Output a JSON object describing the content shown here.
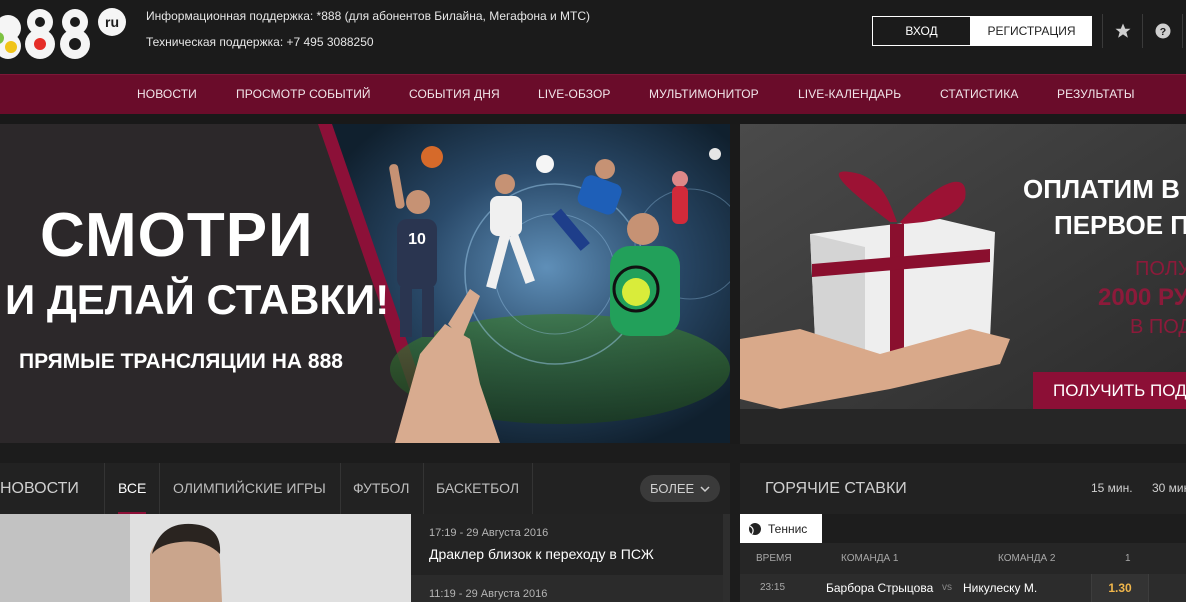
{
  "header": {
    "support_info": "Информационная поддержка: *888 (для абонентов Билайна, Мегафона и МТС)",
    "support_tech": "Техническая поддержка: +7 495 3088250",
    "login_label": "ВХОД",
    "register_label": "РЕГИСТРАЦИЯ",
    "logo_text": "888",
    "logo_domain": "ru"
  },
  "nav": {
    "items": [
      {
        "label": "НОВОСТИ"
      },
      {
        "label": "ПРОСМОТР СОБЫТИЙ"
      },
      {
        "label": "СОБЫТИЯ ДНЯ"
      },
      {
        "label": "LIVE-ОБЗОР"
      },
      {
        "label": "МУЛЬТИМОНИТОР"
      },
      {
        "label": "LIVE-КАЛЕНДАРЬ"
      },
      {
        "label": "СТАТИСТИКА"
      },
      {
        "label": "РЕЗУЛЬТАТЫ"
      }
    ]
  },
  "banner_main": {
    "line1": "СМОТРИ",
    "line2": "И ДЕЛАЙ СТАВКИ!",
    "line3": "ПРЯМЫЕ ТРАНСЛЯЦИИ НА 888",
    "jersey_number": "10"
  },
  "banner_promo": {
    "line1": "ОПЛАТИМ В",
    "line2": "ПЕРВОЕ П",
    "line3": "ПОЛУ",
    "line4": "2000 РУ",
    "line5": "В ПОД",
    "button": "ПОЛУЧИТЬ ПОД"
  },
  "news": {
    "title": "НОВОСТИ",
    "tabs": [
      {
        "label": "ВСЕ"
      },
      {
        "label": "ОЛИМПИЙСКИЕ ИГРЫ"
      },
      {
        "label": "ФУТБОЛ"
      },
      {
        "label": "БАСКЕТБОЛ"
      }
    ],
    "more_label": "БОЛЕЕ",
    "items": [
      {
        "time": "17:19 - 29 Августа 2016",
        "headline": "Драклер близок к переходу в ПСЖ"
      },
      {
        "time": "11:19 - 29 Августа 2016"
      }
    ]
  },
  "hot_bets": {
    "title": "ГОРЯЧИЕ СТАВКИ",
    "time_filters": [
      {
        "label": "15 мин."
      },
      {
        "label": "30 мин"
      }
    ],
    "sport_tab": "Теннис",
    "columns": {
      "time": "ВРЕМЯ",
      "team1": "КОМАНДА 1",
      "team2": "КОМАНДА 2",
      "odd1": "1"
    },
    "rows": [
      {
        "time": "23:15",
        "team1": "Барбора Стрыцова",
        "vs": "vs",
        "team2": "Никулеску М.",
        "odd1": "1.30"
      }
    ]
  },
  "colors": {
    "nav_bg": "#6a0c2a",
    "accent": "#8c0f36",
    "odds": "#f0b64b"
  }
}
